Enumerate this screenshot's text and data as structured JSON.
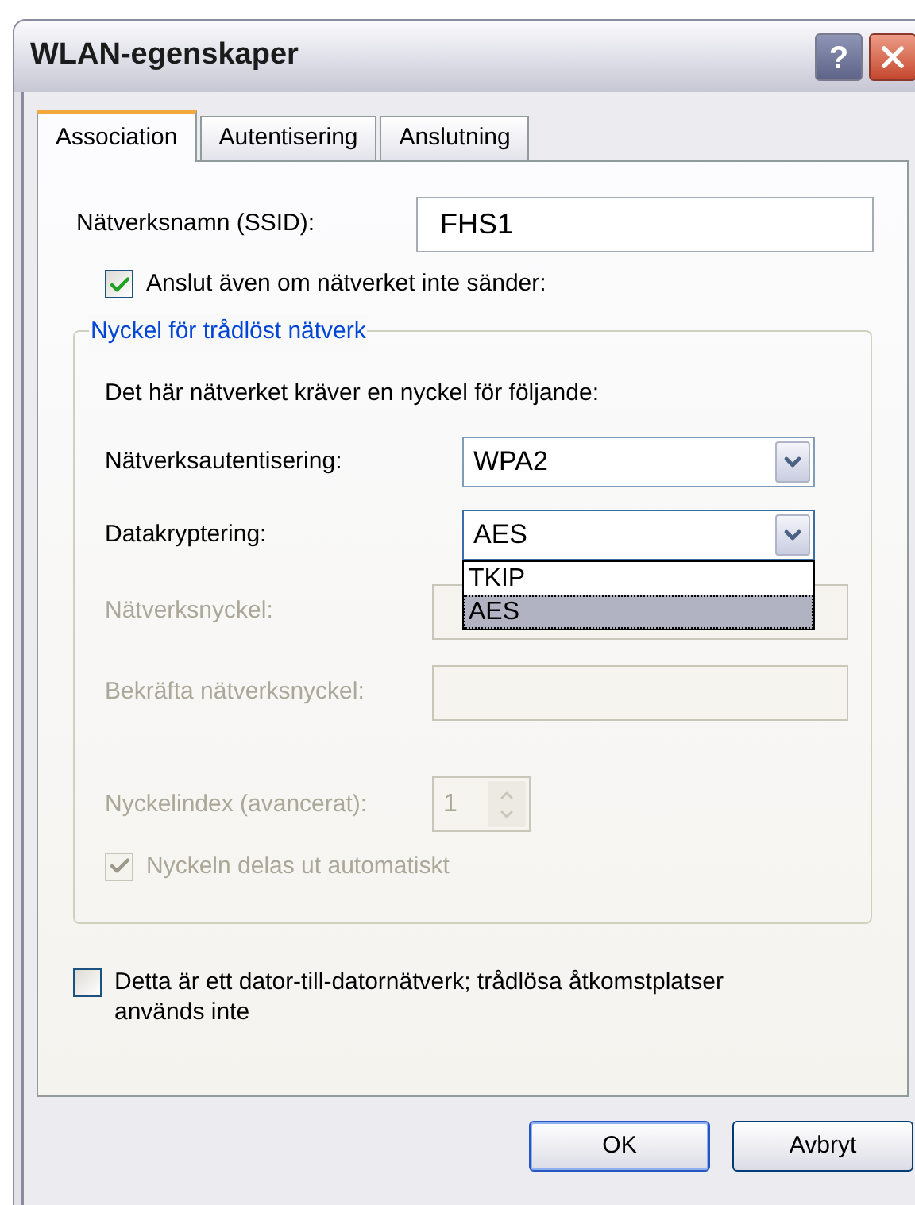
{
  "window": {
    "title": "WLAN-egenskaper"
  },
  "title_buttons": [
    {
      "kind": "help",
      "label": "?"
    },
    {
      "kind": "close"
    }
  ],
  "tabs": [
    {
      "label": "Association",
      "selected": true
    },
    {
      "label": "Autentisering",
      "selected": false
    },
    {
      "label": "Anslutning",
      "selected": false
    }
  ],
  "ssid": {
    "label": "Nätverksnamn (SSID):",
    "value": "FHS1"
  },
  "broadcast_checkbox": {
    "label": "Anslut även om nätverket inte sänder:",
    "checked": true,
    "disabled": false
  },
  "key_group": {
    "legend": "Nyckel för trådlöst nätverk",
    "description": "Det här nätverket kräver en nyckel för följande:",
    "fields": [
      {
        "kind": "select",
        "label": "Nätverksautentisering:",
        "value": "WPA2",
        "disabled": false,
        "expanded": false
      },
      {
        "kind": "select",
        "label": "Datakryptering:",
        "value": "AES",
        "disabled": false,
        "expanded": true,
        "options": [
          {
            "label": "TKIP",
            "selected": false
          },
          {
            "label": "AES",
            "selected": true
          }
        ]
      },
      {
        "kind": "text",
        "label": "Nätverksnyckel:",
        "disabled": true
      },
      {
        "kind": "text",
        "label": "Bekräfta nätverksnyckel:",
        "disabled": true
      },
      {
        "kind": "spin",
        "label": "Nyckelindex (avancerat):",
        "value": "1",
        "disabled": true
      }
    ],
    "auto_checkbox": {
      "label": "Nyckeln delas ut automatiskt",
      "checked": true,
      "disabled": true
    }
  },
  "adhoc_checkbox": {
    "label": "Detta är ett dator-till-datornätverk; trådlösa åtkomstplatser används inte",
    "checked": false,
    "disabled": false
  },
  "buttons": [
    {
      "label": "OK",
      "default": true
    },
    {
      "label": "Avbryt",
      "default": false
    }
  ]
}
